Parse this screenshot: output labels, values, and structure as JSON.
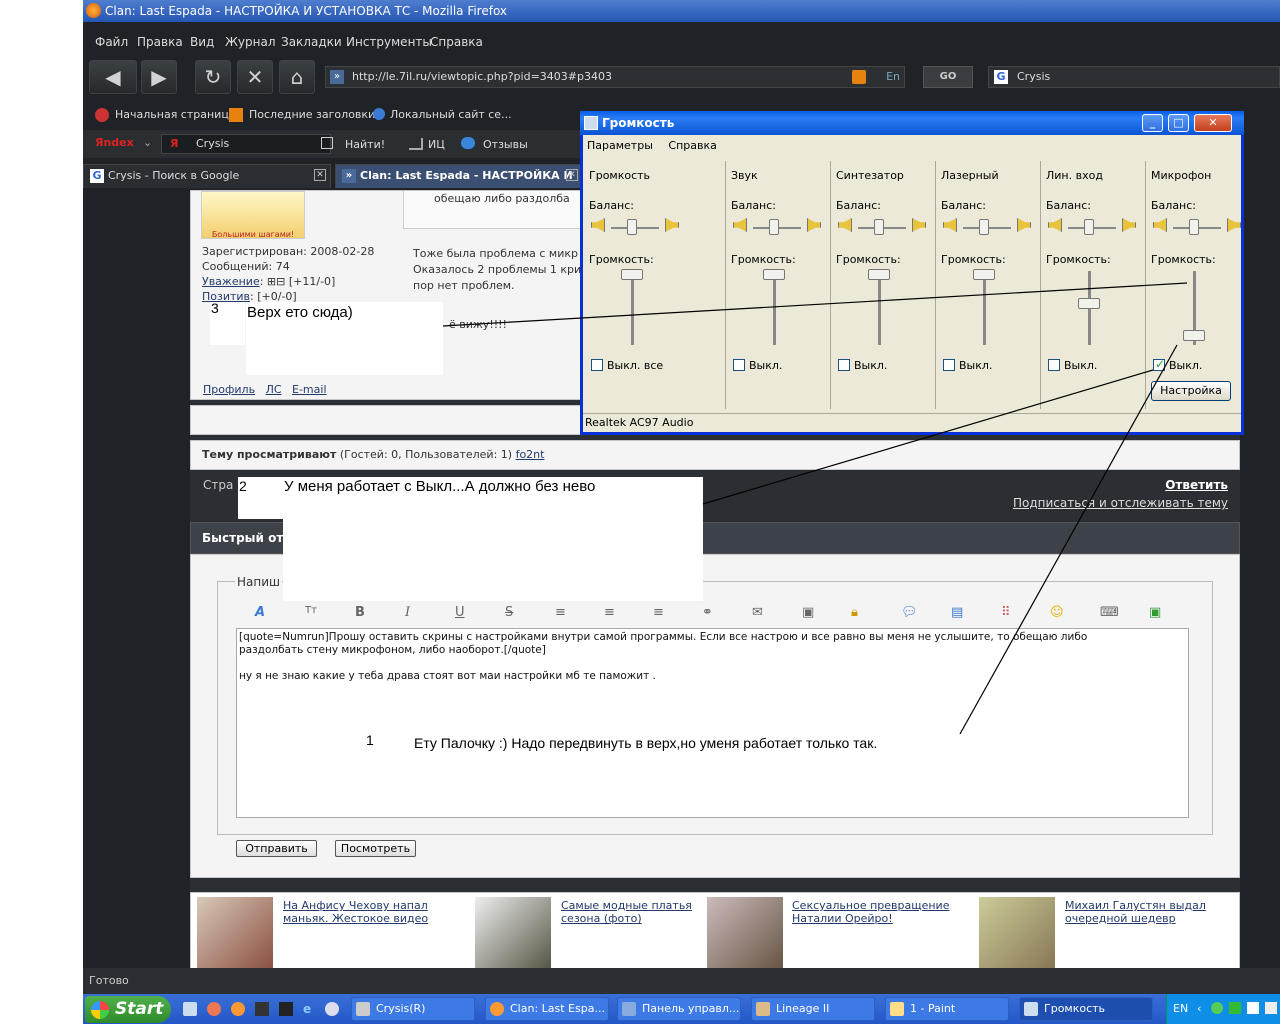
{
  "window": {
    "title": "Clan: Last Espada - НАСТРОЙКА И УСТАНОВКА ТС - Mozilla Firefox"
  },
  "menu": [
    "Файл",
    "Правка",
    "Вид",
    "Журнал",
    "Закладки",
    "Инструменты",
    "Справка"
  ],
  "nav": {
    "url": "http://le.7il.ru/viewtopic.php?pid=3403#p3403",
    "go_label": "GO",
    "search_value": "Crysis",
    "lang": "En"
  },
  "bookmarks": [
    "Начальная страница",
    "Последние заголовки",
    "Локальный сайт се..."
  ],
  "yabar": {
    "logo": "Яndex",
    "search_value": "Crysis",
    "find_label": "Найти!",
    "ic_label": "ИЦ",
    "reviews_label": "Отзывы"
  },
  "tabs": [
    {
      "label": "Crysis - Поиск в Google"
    },
    {
      "label": "Clan: Last Espada - НАСТРОЙКА И ..."
    }
  ],
  "post": {
    "avatar_caption": "Большими шагами!",
    "registered": "Зарегистрирован: 2008-02-28",
    "messages": "Сообщений: 74",
    "respect_label": "Уважение",
    "respect_value": "[+11/-0]",
    "positive_label": "Позитив",
    "positive_value": "[+0/-0]",
    "quote_text": "обещаю либо раздолба",
    "body_line1": "Тоже была проблема с микр",
    "body_line2": "Оказалось 2 проблемы 1 кри",
    "body_line3": "пор нет проблем.",
    "sig_fragment": "ё вижу!!!!",
    "profile_link": "Профиль",
    "pm_link": "ЛС",
    "email_link": "E-mail"
  },
  "viewers": {
    "label": "Тему просматривают",
    "detail": "(Гостей: 0, Пользователей: 1)",
    "user": "fo2nt"
  },
  "pager": {
    "prefix": "Стра",
    "reply_link": "Ответить",
    "subscribe_link": "Подписаться и отслеживать тему"
  },
  "quick_reply": {
    "title": "Быстрый отв",
    "legend": "Напиш",
    "text_line1": "[quote=Numrun]Прошу оставить скрины с настройками внутри самой программы. Если все настрою и все равно вы меня не услышите, то обещаю либо",
    "text_line2": "раздолбать стену микрофоном, либо наоборот.[/quote]",
    "text_line3": "ну я не знаю какие у теба драва стоят вот маи настройки мб те паможит .",
    "submit_label": "Отправить",
    "preview_label": "Посмотреть"
  },
  "news": [
    {
      "title": "На Анфису Чехову напал маньяк. Жестокое видео"
    },
    {
      "title": "Самые модные платья сезона (фото)"
    },
    {
      "title": "Сексуальное превращение Наталии Орейро!"
    },
    {
      "title": "Михаил Галустян выдал очередной шедевр"
    }
  ],
  "annotations": {
    "a1_num": "1",
    "a1_text": "Ету Палочку :) Надо передвинуть в верх,но уменя работает только так.",
    "a2_num": "2",
    "a2_text": "У меня работает с Выкл...А должно без нево",
    "a3_num": "3",
    "a3_text": "Верх ето сюда)"
  },
  "volume": {
    "title": "Громкость",
    "menu": [
      "Параметры",
      "Справка"
    ],
    "balance_label": "Баланс:",
    "volume_label": "Громкость:",
    "columns": [
      {
        "name": "Громкость",
        "mute_label": "Выкл. все",
        "muted": false
      },
      {
        "name": "Звук",
        "mute_label": "Выкл.",
        "muted": false
      },
      {
        "name": "Синтезатор",
        "mute_label": "Выкл.",
        "muted": false
      },
      {
        "name": "Лазерный",
        "mute_label": "Выкл.",
        "muted": false
      },
      {
        "name": "Лин. вход",
        "mute_label": "Выкл.",
        "muted": false
      },
      {
        "name": "Микрофон",
        "mute_label": "Выкл.",
        "muted": true
      }
    ],
    "levels": [
      1.0,
      1.0,
      1.0,
      1.0,
      0.55,
      0.05
    ],
    "settings_label": "Настройка",
    "device": "Realtek AC97 Audio"
  },
  "status": {
    "text": "Готово"
  },
  "taskbar": {
    "start": "Start",
    "items": [
      "Crysis(R)",
      "Clan: Last Espa...",
      "Панель управл...",
      "Lineage II",
      "1 - Paint",
      "Громкость"
    ],
    "lang": "EN"
  }
}
